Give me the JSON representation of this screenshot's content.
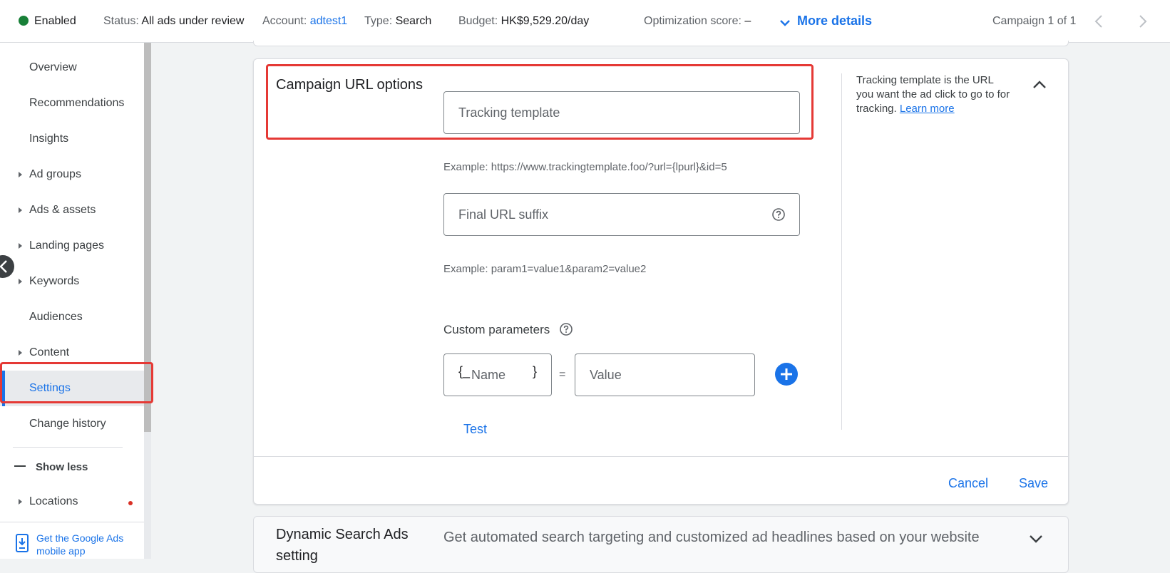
{
  "topbar": {
    "status_enabled": "Enabled",
    "status_label": "Status:",
    "status_value": "All ads under review",
    "account_label": "Account:",
    "account_value": "adtest1",
    "type_label": "Type:",
    "type_value": "Search",
    "budget_label": "Budget:",
    "budget_value": "HK$9,529.20/day",
    "optimization_label": "Optimization score:",
    "optimization_value": "–",
    "more_details": "More details",
    "campaign_counter": "Campaign 1 of 1"
  },
  "sidebar": {
    "items": [
      {
        "label": "Overview"
      },
      {
        "label": "Recommendations"
      },
      {
        "label": "Insights"
      },
      {
        "label": "Ad groups"
      },
      {
        "label": "Ads & assets"
      },
      {
        "label": "Landing pages"
      },
      {
        "label": "Keywords"
      },
      {
        "label": "Audiences"
      },
      {
        "label": "Content"
      },
      {
        "label": "Settings"
      },
      {
        "label": "Change history"
      }
    ],
    "show_less": "Show less",
    "locations": "Locations",
    "mobile_app": "Get the Google Ads mobile app"
  },
  "url_options": {
    "title": "Campaign URL options",
    "tracking_placeholder": "Tracking template",
    "tracking_example": "Example: https://www.trackingtemplate.foo/?url={lpurl}&id=5",
    "suffix_placeholder": "Final URL suffix",
    "suffix_example": "Example: param1=value1&param2=value2",
    "custom_params_label": "Custom parameters",
    "name_open": "{_",
    "name_placeholder": "Name",
    "name_close": "}",
    "equals": "=",
    "value_placeholder": "Value",
    "test": "Test",
    "help_text": "Tracking template is the URL you want the ad click to go to for tracking.",
    "help_link": "Learn more",
    "cancel": "Cancel",
    "save": "Save"
  },
  "dynamic_search": {
    "title": "Dynamic Search Ads setting",
    "description": "Get automated search targeting and customized ad headlines based on your website"
  },
  "colors": {
    "accent": "#1a73e8",
    "enabled": "#188038",
    "highlight": "#e53935"
  }
}
